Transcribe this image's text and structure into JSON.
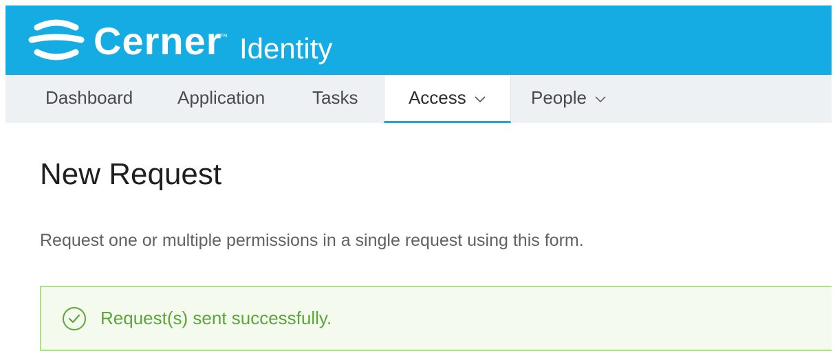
{
  "header": {
    "brand": "Cerner",
    "trademark": "™",
    "product": "Identity",
    "background_color": "#14ace3"
  },
  "nav": {
    "items": [
      {
        "label": "Dashboard",
        "has_dropdown": false,
        "active": false
      },
      {
        "label": "Application",
        "has_dropdown": false,
        "active": false
      },
      {
        "label": "Tasks",
        "has_dropdown": false,
        "active": false
      },
      {
        "label": "Access",
        "has_dropdown": true,
        "active": true
      },
      {
        "label": "People",
        "has_dropdown": true,
        "active": false
      }
    ],
    "active_accent": "#1aa7e0"
  },
  "main": {
    "title": "New Request",
    "description": "Request one or multiple permissions in a single request using this form.",
    "alert": {
      "icon": "check-circle-icon",
      "message": "Request(s) sent successfully.",
      "color": "#5ba63a"
    }
  }
}
